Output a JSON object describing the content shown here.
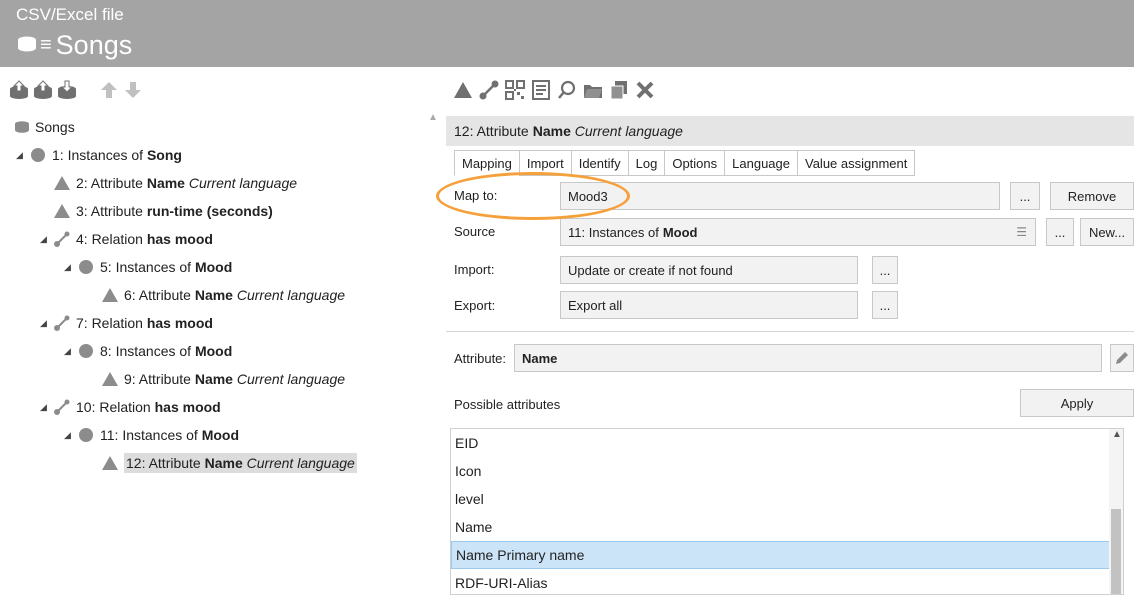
{
  "header": {
    "subtitle": "CSV/Excel file",
    "title": "Songs",
    "menu_glyph": "≡",
    "db_icon": "database-icon"
  },
  "colors": {
    "header_bg": "#a4a4a4",
    "toolbar_icon": "#707070",
    "toolbar_icon_dim": "#c0c0c0",
    "highlight_orange": "#f5a03a",
    "selection_blue": "#cce4f7"
  },
  "left_toolbar": {
    "icons": [
      "db-upload-icon",
      "db-upload-2-icon",
      "db-download-icon",
      "arrow-up-icon",
      "arrow-down-icon"
    ]
  },
  "right_toolbar": {
    "icons": [
      "attribute-triangle-icon",
      "relation-icon",
      "qr-icon",
      "document-icon",
      "search-icon",
      "folder-icon",
      "copy-icon",
      "delete-x-icon"
    ]
  },
  "tree": {
    "root": "Songs",
    "nodes": [
      {
        "prefix": "1: Instances of ",
        "bold": "Song",
        "italic": ""
      },
      {
        "prefix": "2: Attribute ",
        "bold": "Name",
        "italic": "Current language"
      },
      {
        "prefix": "3: Attribute ",
        "bold": "run-time (seconds)",
        "italic": ""
      },
      {
        "prefix": "4: Relation ",
        "bold": "has mood",
        "italic": ""
      },
      {
        "prefix": "5: Instances of ",
        "bold": "Mood",
        "italic": ""
      },
      {
        "prefix": "6: Attribute ",
        "bold": "Name",
        "italic": "Current language"
      },
      {
        "prefix": "7: Relation ",
        "bold": "has mood",
        "italic": ""
      },
      {
        "prefix": "8: Instances of ",
        "bold": "Mood",
        "italic": ""
      },
      {
        "prefix": "9: Attribute ",
        "bold": "Name",
        "italic": "Current language"
      },
      {
        "prefix": "10: Relation ",
        "bold": "has mood",
        "italic": ""
      },
      {
        "prefix": "11: Instances of ",
        "bold": "Mood",
        "italic": ""
      },
      {
        "prefix": "12: Attribute ",
        "bold": "Name",
        "italic": "Current language"
      }
    ]
  },
  "panel": {
    "title_prefix": "12: Attribute ",
    "title_bold": "Name",
    "title_italic": "Current language",
    "tabs": [
      "Mapping",
      "Import",
      "Identify",
      "Log",
      "Options",
      "Language",
      "Value assignment"
    ],
    "map_to_label": "Map to:",
    "map_to_value": "Mood3",
    "ellipsis": "...",
    "remove_label": "Remove",
    "source_label": "Source",
    "source_prefix": "11: Instances of ",
    "source_bold": "Mood",
    "new_label": "New...",
    "import_label": "Import:",
    "import_value": "Update or create if not found",
    "export_label": "Export:",
    "export_value": "Export all",
    "attribute_label": "Attribute:",
    "attribute_value": "Name",
    "possible_label": "Possible attributes",
    "apply_label": "Apply",
    "possible_items": [
      "EID",
      "Icon",
      "level",
      "Name",
      "Name Primary name",
      "RDF-URI-Alias"
    ],
    "selected_item": "Name Primary name"
  }
}
